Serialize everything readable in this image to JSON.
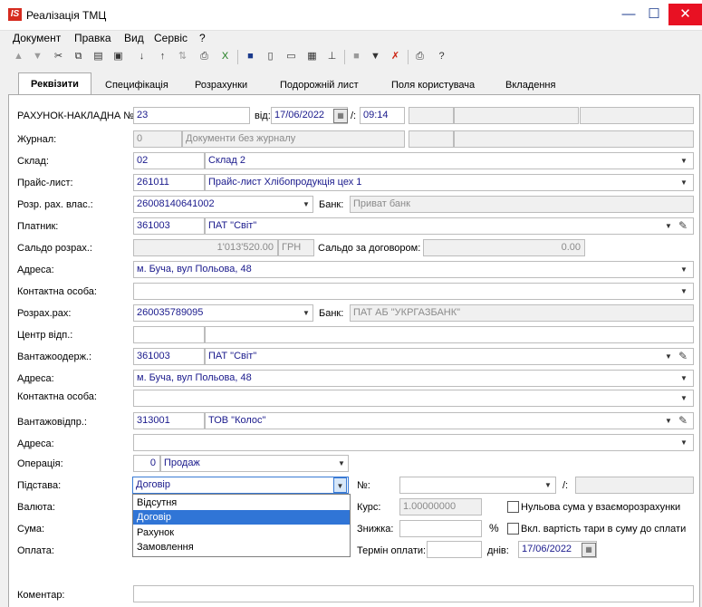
{
  "window": {
    "logo_text": "IS",
    "title": "Реалізація ТМЦ",
    "min_glyph": "—",
    "max_glyph": "☐",
    "close_glyph": "✕"
  },
  "menu": [
    "Документ",
    "Правка",
    "Вид",
    "Сервіс",
    "?"
  ],
  "tabs": [
    "Реквізити",
    "Специфікація",
    "Розрахунки",
    "Подорожній лист",
    "Поля користувача",
    "Вкладення"
  ],
  "form": {
    "invoice_label": "РАХУНОК-НАКЛАДНА №:",
    "invoice_no": "23",
    "from_label": "від:",
    "date": "17/06/2022",
    "time_sep": "/:",
    "time": "09:14",
    "journal_label": "Журнал:",
    "journal_code": "0",
    "journal_name": "Документи без журналу",
    "warehouse_label": "Склад:",
    "warehouse_code": "02",
    "warehouse_name": "Склад 2",
    "pricelist_label": "Прайс-лист:",
    "pricelist_code": "261011",
    "pricelist_name": "Прайс-лист Хлібопродукція цех 1",
    "own_account_label": "Розр. рах. влас.:",
    "own_account": "26008140641002",
    "bank_label": "Банк:",
    "own_bank": "Приват банк",
    "payer_label": "Платник:",
    "payer_code": "361003",
    "payer_name": "ПАТ \"Світ\"",
    "balance_label": "Сальдо розрах.:",
    "balance_value": "1'013'520.00",
    "currency_short": "ГРН",
    "contract_balance_label": "Сальдо за договором:",
    "contract_balance_value": "0.00",
    "address_label": "Адреса:",
    "payer_address": "м. Буча, вул Польова, 48",
    "contact_label": "Контактна особа:",
    "contact_value": "",
    "settlement_account_label": "Розрах.рах:",
    "settlement_account": "260035789095",
    "settlement_bank": "ПАТ АБ \"УКРГАЗБАНК\"",
    "resp_center_label": "Центр відп.:",
    "consignee_label": "Вантажоодерж.:",
    "consignee_code": "361003",
    "consignee_name": "ПАТ \"Світ\"",
    "consignee_address": "м. Буча, вул Польова, 48",
    "shipper_label": "Вантажовідпр.:",
    "shipper_code": "313001",
    "shipper_name": "ТОВ \"Колос\"",
    "shipper_address": "",
    "operation_label": "Операція:",
    "operation_code": "0",
    "operation_name": "Продаж",
    "basis_label": "Підстава:",
    "basis_value": "Договір",
    "number_label": "№:",
    "number_sep": "/:",
    "currency_label": "Валюта:",
    "rate_label": "Курс:",
    "rate_value": "1.00000000",
    "zero_sum_label": "Нульова сума у взаєморозрахунки",
    "sum_label": "Сума:",
    "discount_label": "Знижка:",
    "percent": "%",
    "tare_label": "Вкл. вартість тари в суму до сплати",
    "payment_label": "Оплата:",
    "payment_term_label": "Термін оплати:",
    "days_label": "днів:",
    "payment_date": "17/06/2022",
    "comment_label": "Коментар:"
  },
  "basis_options": [
    {
      "label": "Відсутня",
      "selected": false
    },
    {
      "label": "Договір",
      "selected": true
    },
    {
      "label": "Рахунок",
      "selected": false
    },
    {
      "label": "Замовлення",
      "selected": false
    }
  ],
  "colors": {
    "accent": "#1a1a8c",
    "selection": "#3075d6",
    "logo": "#d62b1f"
  }
}
